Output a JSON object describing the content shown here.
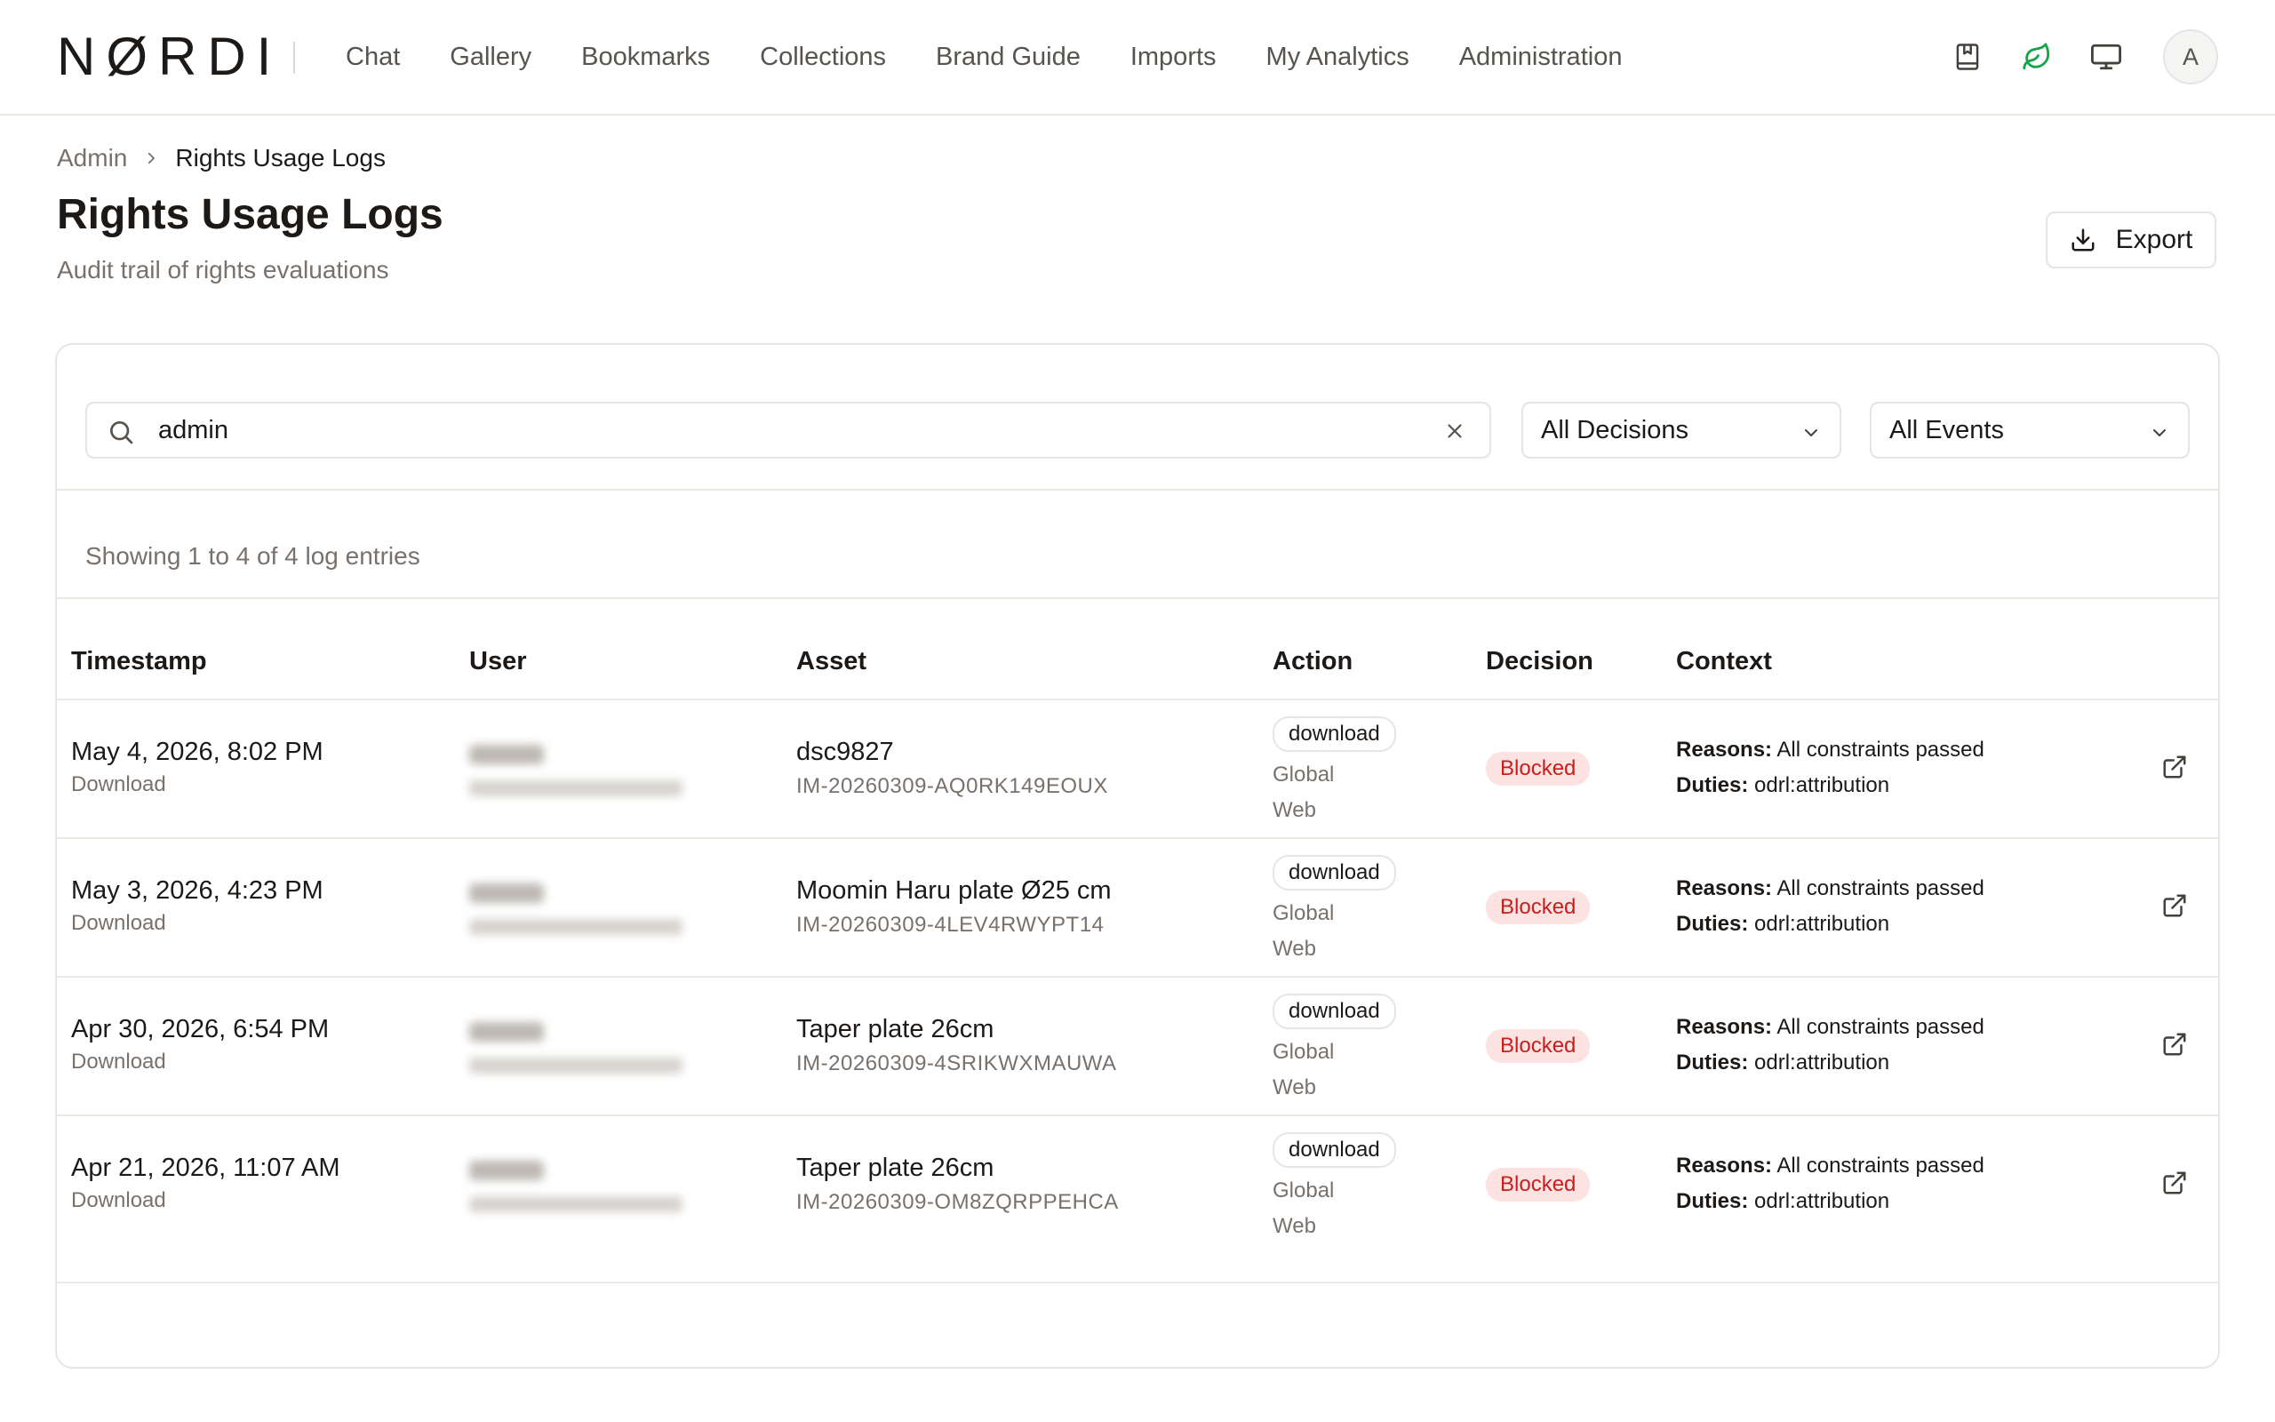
{
  "app": {
    "logo": "NØRDI",
    "nav": [
      "Chat",
      "Gallery",
      "Bookmarks",
      "Collections",
      "Brand Guide",
      "Imports",
      "My Analytics",
      "Administration"
    ],
    "icons": [
      "bookmark-book-icon",
      "leaf-icon",
      "monitor-icon"
    ],
    "avatar_initial": "A",
    "accent": "#16a34a"
  },
  "breadcrumb": {
    "parent": "Admin",
    "current": "Rights Usage Logs"
  },
  "page": {
    "title": "Rights Usage Logs",
    "subtitle": "Audit trail of rights evaluations",
    "export_label": "Export"
  },
  "filters": {
    "search_value": "admin",
    "decision_selected": "All Decisions",
    "event_selected": "All Events"
  },
  "summary": "Showing 1 to 4 of 4 log entries",
  "table": {
    "headers": [
      "Timestamp",
      "User",
      "Asset",
      "Action",
      "Decision",
      "Context"
    ],
    "context_labels": {
      "reasons": "Reasons:",
      "duties": "Duties:"
    },
    "rows": [
      {
        "timestamp": "May 4, 2026, 8:02 PM",
        "event": "Download",
        "asset_name": "dsc9827",
        "asset_id": "IM-20260309-AQ0RK149EOUX",
        "action": "download",
        "scope": "Global",
        "channel": "Web",
        "decision": "Blocked",
        "reasons": "All constraints passed",
        "duties": "odrl:attribution"
      },
      {
        "timestamp": "May 3, 2026, 4:23 PM",
        "event": "Download",
        "asset_name": "Moomin Haru plate Ø25 cm",
        "asset_id": "IM-20260309-4LEV4RWYPT14",
        "action": "download",
        "scope": "Global",
        "channel": "Web",
        "decision": "Blocked",
        "reasons": "All constraints passed",
        "duties": "odrl:attribution"
      },
      {
        "timestamp": "Apr 30, 2026, 6:54 PM",
        "event": "Download",
        "asset_name": "Taper plate 26cm",
        "asset_id": "IM-20260309-4SRIKWXMAUWA",
        "action": "download",
        "scope": "Global",
        "channel": "Web",
        "decision": "Blocked",
        "reasons": "All constraints passed",
        "duties": "odrl:attribution"
      },
      {
        "timestamp": "Apr 21, 2026, 11:07 AM",
        "event": "Download",
        "asset_name": "Taper plate 26cm",
        "asset_id": "IM-20260309-OM8ZQRPPEHCA",
        "action": "download",
        "scope": "Global",
        "channel": "Web",
        "decision": "Blocked",
        "reasons": "All constraints passed",
        "duties": "odrl:attribution"
      }
    ]
  }
}
